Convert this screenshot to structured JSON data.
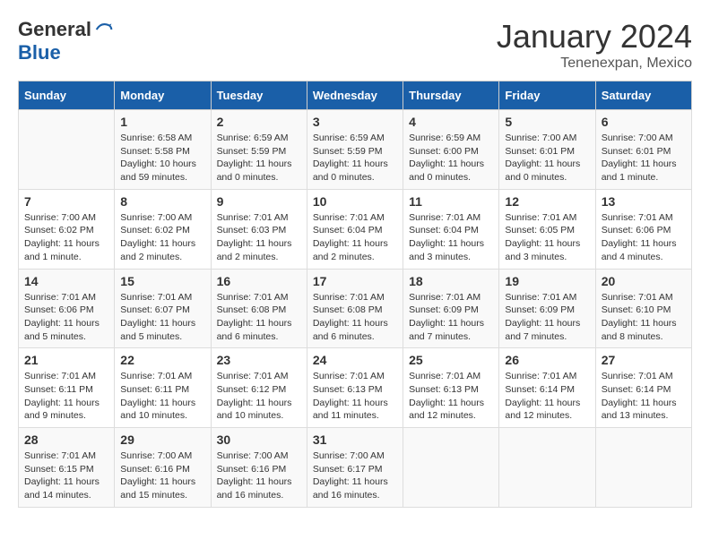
{
  "logo": {
    "general": "General",
    "blue": "Blue"
  },
  "title": "January 2024",
  "subtitle": "Tenenexpan, Mexico",
  "days_of_week": [
    "Sunday",
    "Monday",
    "Tuesday",
    "Wednesday",
    "Thursday",
    "Friday",
    "Saturday"
  ],
  "weeks": [
    [
      {
        "date": "",
        "sunrise": "",
        "sunset": "",
        "daylight": ""
      },
      {
        "date": "1",
        "sunrise": "Sunrise: 6:58 AM",
        "sunset": "Sunset: 5:58 PM",
        "daylight": "Daylight: 10 hours and 59 minutes."
      },
      {
        "date": "2",
        "sunrise": "Sunrise: 6:59 AM",
        "sunset": "Sunset: 5:59 PM",
        "daylight": "Daylight: 11 hours and 0 minutes."
      },
      {
        "date": "3",
        "sunrise": "Sunrise: 6:59 AM",
        "sunset": "Sunset: 5:59 PM",
        "daylight": "Daylight: 11 hours and 0 minutes."
      },
      {
        "date": "4",
        "sunrise": "Sunrise: 6:59 AM",
        "sunset": "Sunset: 6:00 PM",
        "daylight": "Daylight: 11 hours and 0 minutes."
      },
      {
        "date": "5",
        "sunrise": "Sunrise: 7:00 AM",
        "sunset": "Sunset: 6:01 PM",
        "daylight": "Daylight: 11 hours and 0 minutes."
      },
      {
        "date": "6",
        "sunrise": "Sunrise: 7:00 AM",
        "sunset": "Sunset: 6:01 PM",
        "daylight": "Daylight: 11 hours and 1 minute."
      }
    ],
    [
      {
        "date": "7",
        "sunrise": "Sunrise: 7:00 AM",
        "sunset": "Sunset: 6:02 PM",
        "daylight": "Daylight: 11 hours and 1 minute."
      },
      {
        "date": "8",
        "sunrise": "Sunrise: 7:00 AM",
        "sunset": "Sunset: 6:02 PM",
        "daylight": "Daylight: 11 hours and 2 minutes."
      },
      {
        "date": "9",
        "sunrise": "Sunrise: 7:01 AM",
        "sunset": "Sunset: 6:03 PM",
        "daylight": "Daylight: 11 hours and 2 minutes."
      },
      {
        "date": "10",
        "sunrise": "Sunrise: 7:01 AM",
        "sunset": "Sunset: 6:04 PM",
        "daylight": "Daylight: 11 hours and 2 minutes."
      },
      {
        "date": "11",
        "sunrise": "Sunrise: 7:01 AM",
        "sunset": "Sunset: 6:04 PM",
        "daylight": "Daylight: 11 hours and 3 minutes."
      },
      {
        "date": "12",
        "sunrise": "Sunrise: 7:01 AM",
        "sunset": "Sunset: 6:05 PM",
        "daylight": "Daylight: 11 hours and 3 minutes."
      },
      {
        "date": "13",
        "sunrise": "Sunrise: 7:01 AM",
        "sunset": "Sunset: 6:06 PM",
        "daylight": "Daylight: 11 hours and 4 minutes."
      }
    ],
    [
      {
        "date": "14",
        "sunrise": "Sunrise: 7:01 AM",
        "sunset": "Sunset: 6:06 PM",
        "daylight": "Daylight: 11 hours and 5 minutes."
      },
      {
        "date": "15",
        "sunrise": "Sunrise: 7:01 AM",
        "sunset": "Sunset: 6:07 PM",
        "daylight": "Daylight: 11 hours and 5 minutes."
      },
      {
        "date": "16",
        "sunrise": "Sunrise: 7:01 AM",
        "sunset": "Sunset: 6:08 PM",
        "daylight": "Daylight: 11 hours and 6 minutes."
      },
      {
        "date": "17",
        "sunrise": "Sunrise: 7:01 AM",
        "sunset": "Sunset: 6:08 PM",
        "daylight": "Daylight: 11 hours and 6 minutes."
      },
      {
        "date": "18",
        "sunrise": "Sunrise: 7:01 AM",
        "sunset": "Sunset: 6:09 PM",
        "daylight": "Daylight: 11 hours and 7 minutes."
      },
      {
        "date": "19",
        "sunrise": "Sunrise: 7:01 AM",
        "sunset": "Sunset: 6:09 PM",
        "daylight": "Daylight: 11 hours and 7 minutes."
      },
      {
        "date": "20",
        "sunrise": "Sunrise: 7:01 AM",
        "sunset": "Sunset: 6:10 PM",
        "daylight": "Daylight: 11 hours and 8 minutes."
      }
    ],
    [
      {
        "date": "21",
        "sunrise": "Sunrise: 7:01 AM",
        "sunset": "Sunset: 6:11 PM",
        "daylight": "Daylight: 11 hours and 9 minutes."
      },
      {
        "date": "22",
        "sunrise": "Sunrise: 7:01 AM",
        "sunset": "Sunset: 6:11 PM",
        "daylight": "Daylight: 11 hours and 10 minutes."
      },
      {
        "date": "23",
        "sunrise": "Sunrise: 7:01 AM",
        "sunset": "Sunset: 6:12 PM",
        "daylight": "Daylight: 11 hours and 10 minutes."
      },
      {
        "date": "24",
        "sunrise": "Sunrise: 7:01 AM",
        "sunset": "Sunset: 6:13 PM",
        "daylight": "Daylight: 11 hours and 11 minutes."
      },
      {
        "date": "25",
        "sunrise": "Sunrise: 7:01 AM",
        "sunset": "Sunset: 6:13 PM",
        "daylight": "Daylight: 11 hours and 12 minutes."
      },
      {
        "date": "26",
        "sunrise": "Sunrise: 7:01 AM",
        "sunset": "Sunset: 6:14 PM",
        "daylight": "Daylight: 11 hours and 12 minutes."
      },
      {
        "date": "27",
        "sunrise": "Sunrise: 7:01 AM",
        "sunset": "Sunset: 6:14 PM",
        "daylight": "Daylight: 11 hours and 13 minutes."
      }
    ],
    [
      {
        "date": "28",
        "sunrise": "Sunrise: 7:01 AM",
        "sunset": "Sunset: 6:15 PM",
        "daylight": "Daylight: 11 hours and 14 minutes."
      },
      {
        "date": "29",
        "sunrise": "Sunrise: 7:00 AM",
        "sunset": "Sunset: 6:16 PM",
        "daylight": "Daylight: 11 hours and 15 minutes."
      },
      {
        "date": "30",
        "sunrise": "Sunrise: 7:00 AM",
        "sunset": "Sunset: 6:16 PM",
        "daylight": "Daylight: 11 hours and 16 minutes."
      },
      {
        "date": "31",
        "sunrise": "Sunrise: 7:00 AM",
        "sunset": "Sunset: 6:17 PM",
        "daylight": "Daylight: 11 hours and 16 minutes."
      },
      {
        "date": "",
        "sunrise": "",
        "sunset": "",
        "daylight": ""
      },
      {
        "date": "",
        "sunrise": "",
        "sunset": "",
        "daylight": ""
      },
      {
        "date": "",
        "sunrise": "",
        "sunset": "",
        "daylight": ""
      }
    ]
  ]
}
